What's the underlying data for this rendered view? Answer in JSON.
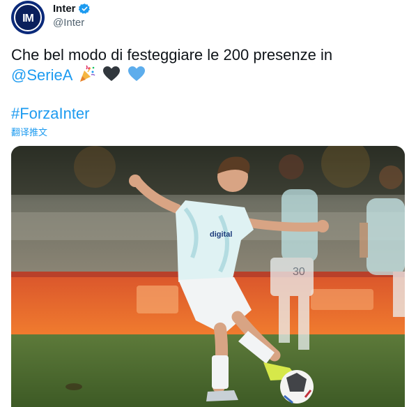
{
  "author": {
    "display_name": "Inter",
    "handle": "@Inter",
    "verified": true,
    "avatar_icon": "inter-crest-icon"
  },
  "tweet": {
    "text_main": "Che bel modo di festeggiare le 200 presenze in",
    "mention": "@SerieA",
    "emojis": [
      "party-popper-icon",
      "black-heart-icon",
      "blue-heart-icon"
    ],
    "hashtag": "#ForzaInter",
    "translate_label": "翻译推文"
  },
  "media": {
    "jersey_sponsor": "digital",
    "shirt_number_partial": "30"
  },
  "colors": {
    "link": "#1d9bf0",
    "text": "#0f1419",
    "secondary": "#536471",
    "verified": "#1d9bf0",
    "inter_blue": "#0b2a7a"
  }
}
